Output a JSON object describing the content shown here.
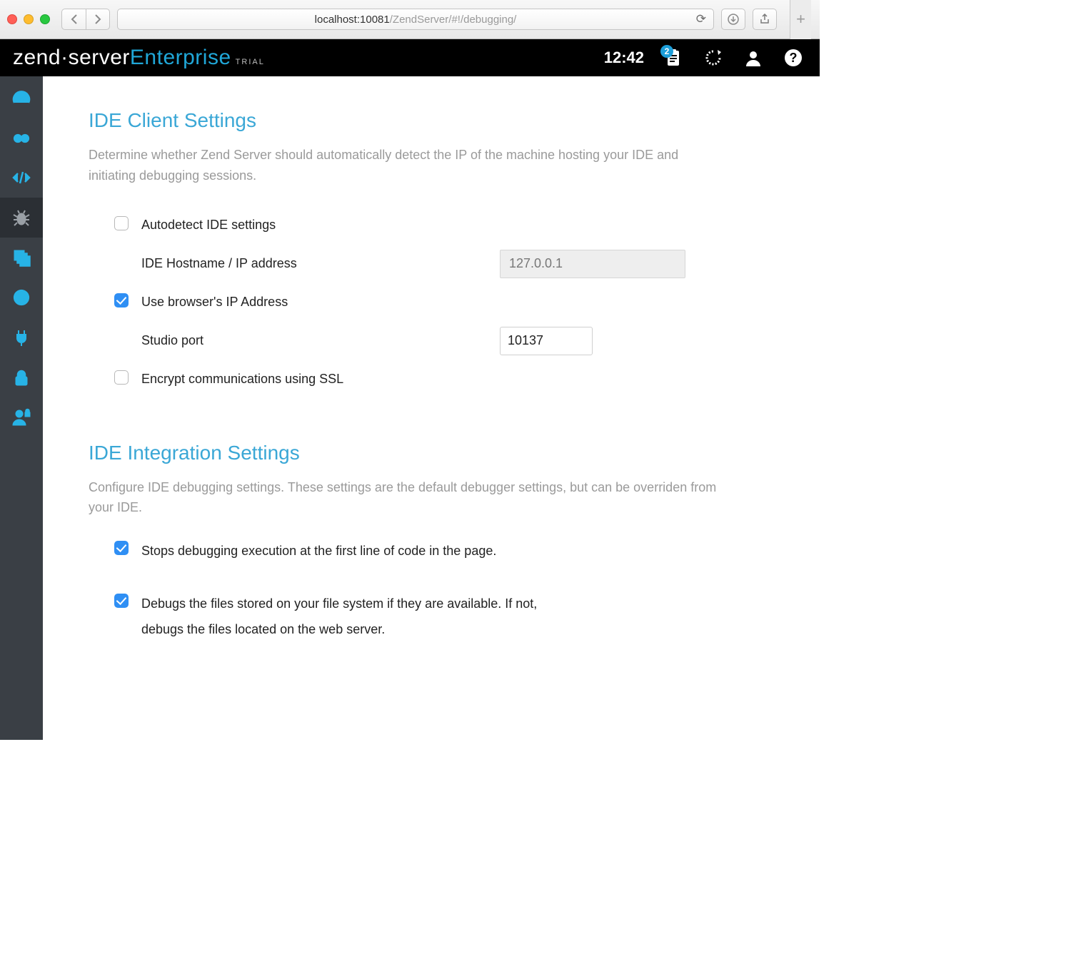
{
  "browser": {
    "url_host": "localhost:10081",
    "url_path": "/ZendServer/#!/debugging/"
  },
  "brand": {
    "zend": "zend",
    "server": "server",
    "enterprise": "Enterprise",
    "trial": "TRIAL"
  },
  "header": {
    "time": "12:42",
    "notifications_count": "2"
  },
  "sidebar": {
    "items": [
      {
        "name": "dashboard"
      },
      {
        "name": "monitor"
      },
      {
        "name": "code"
      },
      {
        "name": "bug"
      },
      {
        "name": "cache"
      },
      {
        "name": "globe"
      },
      {
        "name": "plugin"
      },
      {
        "name": "security"
      },
      {
        "name": "users"
      }
    ]
  },
  "sections": {
    "client": {
      "title": "IDE Client Settings",
      "desc": "Determine whether Zend Server should automatically detect the IP of the machine hosting your IDE and initiating debugging sessions.",
      "autodetect_label": "Autodetect IDE settings",
      "autodetect_checked": false,
      "hostname_label": "IDE Hostname / IP address",
      "hostname_value": "127.0.0.1",
      "use_browser_ip_label": "Use browser's IP Address",
      "use_browser_ip_checked": true,
      "studio_port_label": "Studio port",
      "studio_port_value": "10137",
      "ssl_label": "Encrypt communications using SSL",
      "ssl_checked": false
    },
    "integration": {
      "title": "IDE Integration Settings",
      "desc": "Configure IDE debugging settings. These settings are the default debugger settings, but can be overriden from your IDE.",
      "stop_first_line_label": "Stops debugging execution at the first line of code in the page.",
      "stop_first_line_checked": true,
      "local_copy_label": "Debugs the files stored on your file system if they are available. If not, debugs the files located on the web server.",
      "local_copy_checked": true
    }
  }
}
